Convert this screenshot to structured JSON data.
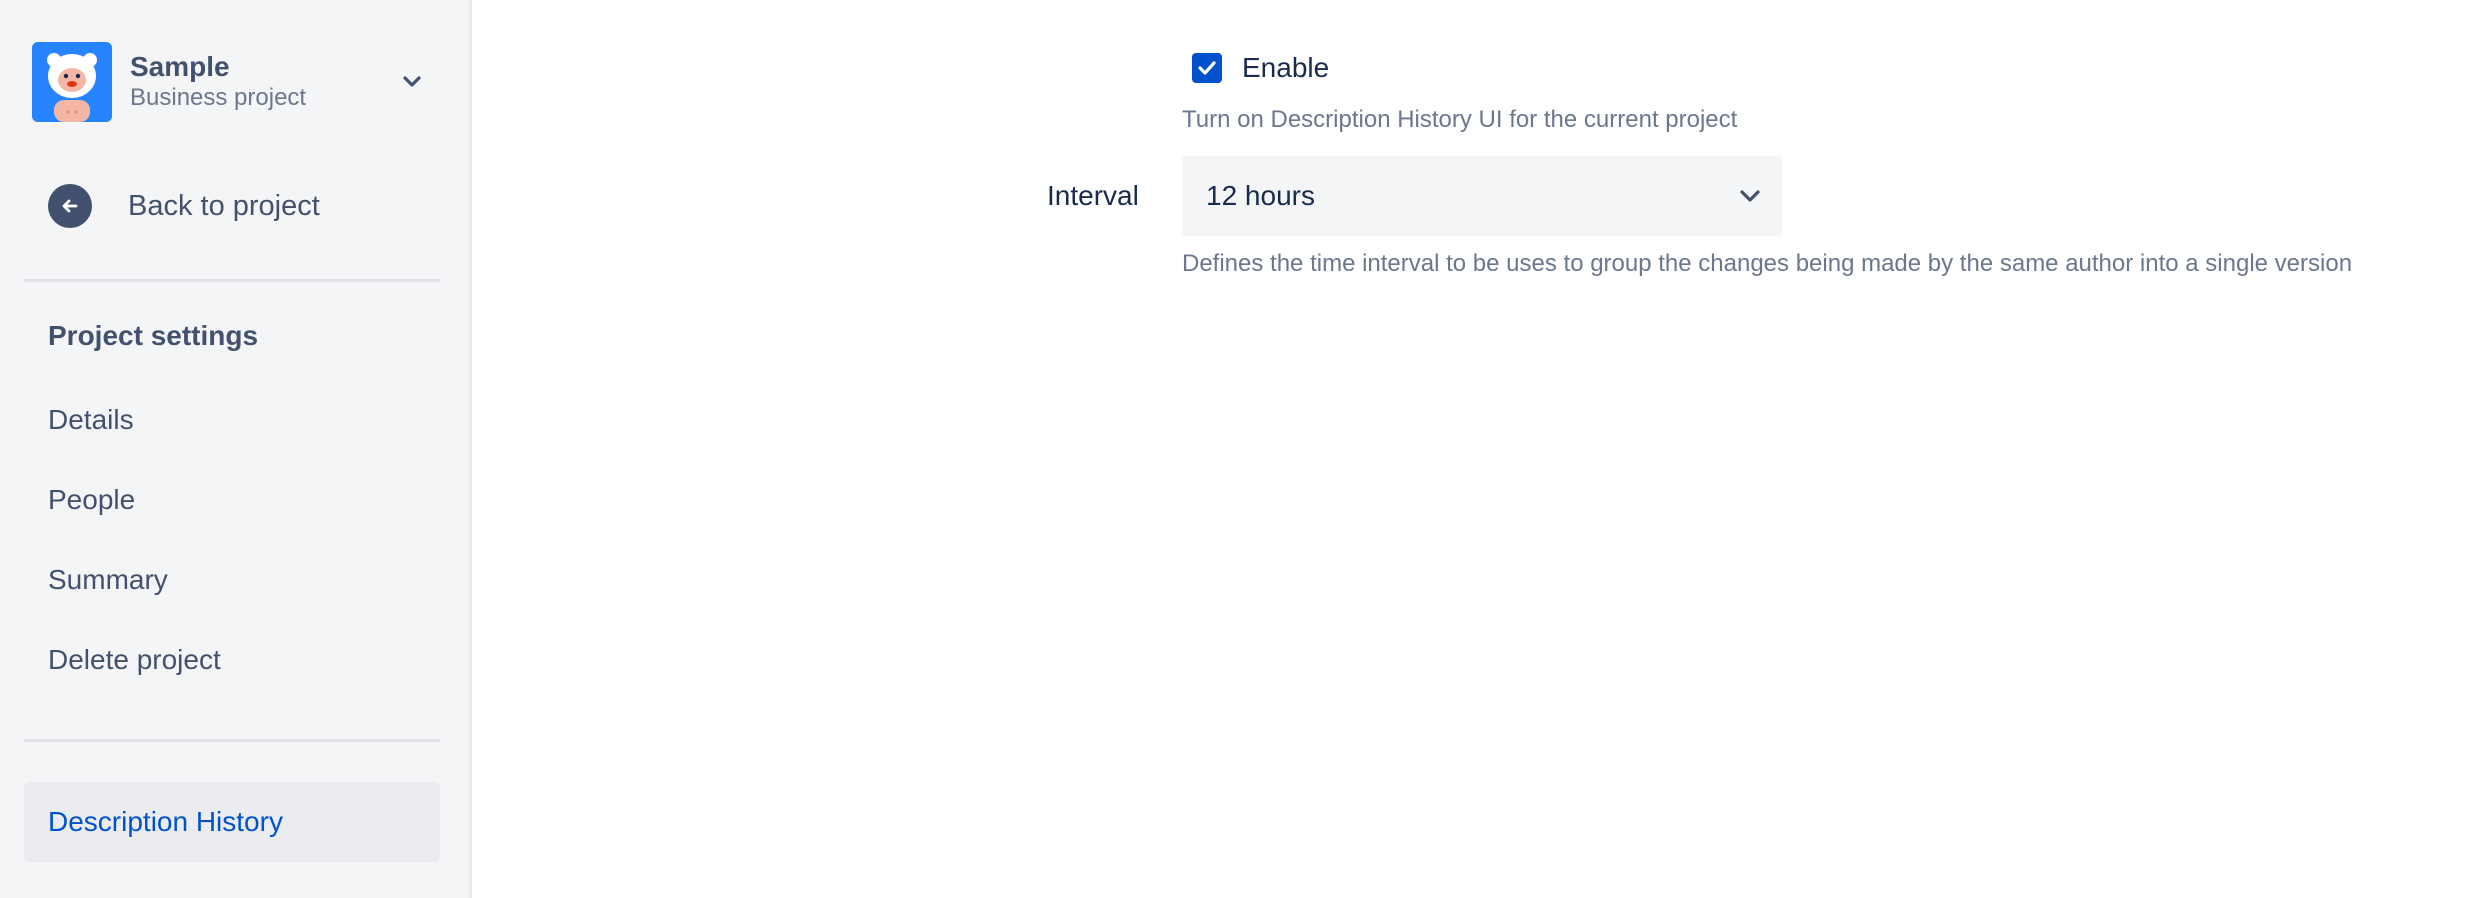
{
  "sidebar": {
    "project": {
      "name": "Sample",
      "type": "Business project",
      "avatar_icon": "yeti-avatar-icon"
    },
    "back_link": {
      "label": "Back to project",
      "icon": "arrow-left-circle-icon"
    },
    "section_title": "Project settings",
    "items": [
      {
        "label": "Details"
      },
      {
        "label": "People"
      },
      {
        "label": "Summary"
      },
      {
        "label": "Delete project"
      }
    ],
    "active_item": {
      "label": "Description History"
    }
  },
  "main": {
    "enable": {
      "checked": true,
      "label": "Enable",
      "help": "Turn on Description History UI for the current project"
    },
    "interval": {
      "label": "Interval",
      "value": "12 hours",
      "help": "Defines the time interval to be uses to group the changes being made by the same author into a single version"
    }
  },
  "colors": {
    "sidebar_bg": "#f4f5f7",
    "accent": "#0052cc",
    "text_primary": "#172b4d",
    "text_secondary": "#6b778c",
    "nav_text": "#42526e",
    "avatar_bg": "#2684ff"
  }
}
